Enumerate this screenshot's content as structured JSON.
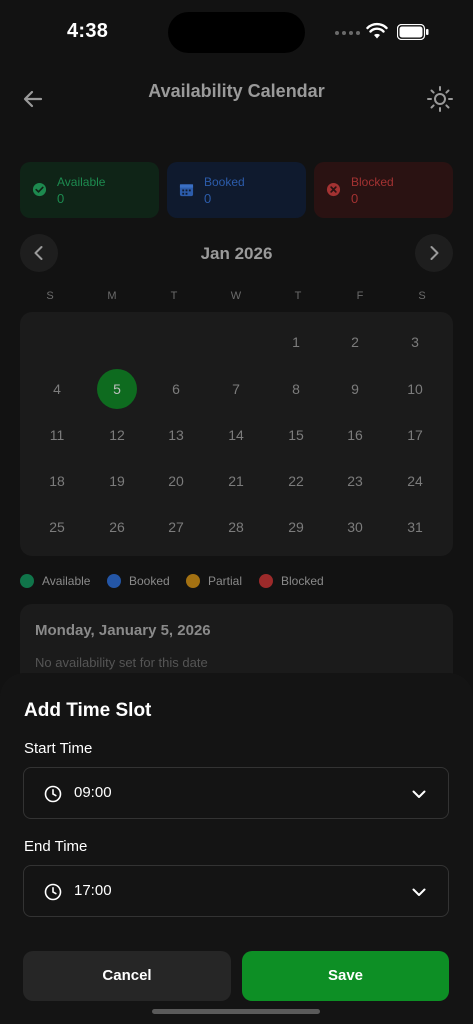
{
  "status_bar": {
    "time": "4:38"
  },
  "header": {
    "title": "Availability Calendar"
  },
  "stats": [
    {
      "key": "available",
      "label": "Available",
      "count": "0",
      "color": "#1d8a4f"
    },
    {
      "key": "booked",
      "label": "Booked",
      "count": "0",
      "color": "#2c5cab"
    },
    {
      "key": "blocked",
      "label": "Blocked",
      "count": "0",
      "color": "#a33232"
    }
  ],
  "calendar": {
    "month_label": "Jan 2026",
    "weekdays": [
      "S",
      "M",
      "T",
      "W",
      "T",
      "F",
      "S"
    ],
    "selected_day": "5",
    "days": [
      "1",
      "2",
      "3",
      "4",
      "5",
      "6",
      "7",
      "8",
      "9",
      "10",
      "11",
      "12",
      "13",
      "14",
      "15",
      "16",
      "17",
      "18",
      "19",
      "20",
      "21",
      "22",
      "23",
      "24",
      "25",
      "26",
      "27",
      "28",
      "29",
      "30",
      "31"
    ]
  },
  "legend": [
    {
      "label": "Available",
      "color": "#10754a"
    },
    {
      "label": "Booked",
      "color": "#2456a6"
    },
    {
      "label": "Partial",
      "color": "#a37112"
    },
    {
      "label": "Blocked",
      "color": "#9c2a2a"
    }
  ],
  "date_panel": {
    "title": "Monday, January 5, 2026",
    "empty_text": "No availability set for this date"
  },
  "sheet": {
    "title": "Add Time Slot",
    "start_label": "Start Time",
    "start_value": "09:00",
    "end_label": "End Time",
    "end_value": "17:00",
    "cancel_label": "Cancel",
    "save_label": "Save"
  },
  "icons": {
    "back": "arrow-left-icon",
    "theme": "sun-icon",
    "prev": "chevron-left-icon",
    "next": "chevron-right-icon",
    "clock": "clock-icon",
    "dropdown": "chevron-down-icon"
  },
  "colors": {
    "accent": "#0d8f25",
    "selected_day": "#0e6b1f"
  }
}
